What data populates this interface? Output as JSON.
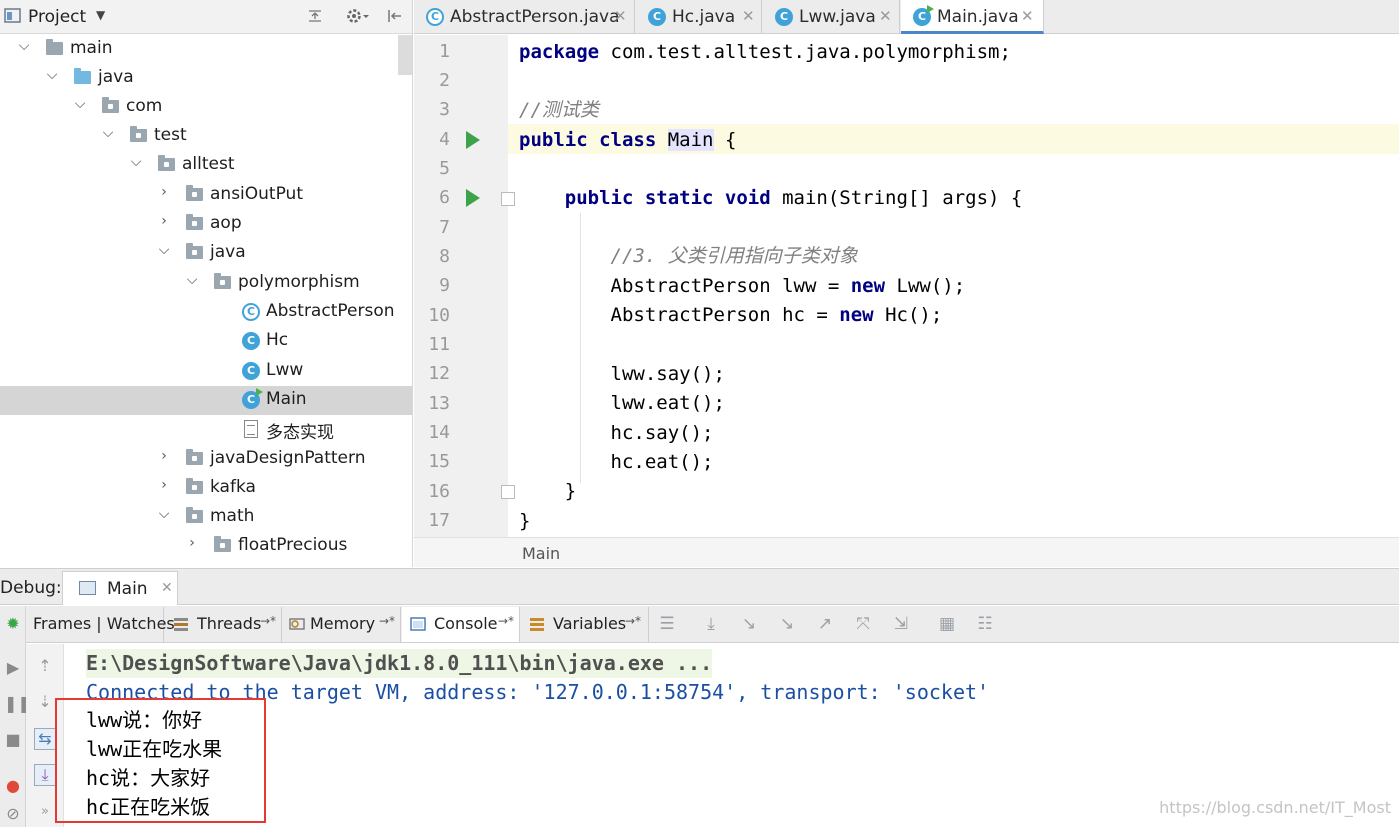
{
  "project_panel": {
    "title": "Project",
    "dropdown": "▼",
    "tree": [
      {
        "label": "main",
        "kind": "folder"
      },
      {
        "label": "java",
        "kind": "src-folder"
      },
      {
        "label": "com",
        "kind": "package"
      },
      {
        "label": "test",
        "kind": "package"
      },
      {
        "label": "alltest",
        "kind": "package"
      },
      {
        "label": "ansiOutPut",
        "kind": "package"
      },
      {
        "label": "aop",
        "kind": "package"
      },
      {
        "label": "java",
        "kind": "package"
      },
      {
        "label": "polymorphism",
        "kind": "package"
      },
      {
        "label": "AbstractPerson",
        "kind": "abstract-class"
      },
      {
        "label": "Hc",
        "kind": "class"
      },
      {
        "label": "Lww",
        "kind": "class"
      },
      {
        "label": "Main",
        "kind": "main-class",
        "selected": true
      },
      {
        "label": "多态实现",
        "kind": "file"
      },
      {
        "label": "javaDesignPattern",
        "kind": "package"
      },
      {
        "label": "kafka",
        "kind": "package"
      },
      {
        "label": "math",
        "kind": "package"
      },
      {
        "label": "floatPrecious",
        "kind": "package"
      }
    ]
  },
  "editor_tabs": [
    {
      "label": "AbstractPerson.java",
      "active": false
    },
    {
      "label": "Hc.java",
      "active": false
    },
    {
      "label": "Lww.java",
      "active": false
    },
    {
      "label": "Main.java",
      "active": true
    }
  ],
  "editor": {
    "line_numbers": [
      "1",
      "2",
      "3",
      "4",
      "5",
      "6",
      "7",
      "8",
      "9",
      "10",
      "11",
      "12",
      "13",
      "14",
      "15",
      "16",
      "17"
    ],
    "code": {
      "l1_kw": "package",
      "l1_rest": " com.test.alltest.java.polymorphism;",
      "l3": "//测试类",
      "l4_kw": "public class",
      "l4_name": "Main",
      "l4_rest": " {",
      "l6_indent": "    ",
      "l6_kw": "public static void",
      "l6_rest": " main(String[] args) {",
      "l8": "        //3. 父类引用指向子类对象",
      "l9_a": "        AbstractPerson lww = ",
      "l9_kw": "new",
      "l9_b": " Lww();",
      "l10_a": "        AbstractPerson hc = ",
      "l10_kw": "new",
      "l10_b": " Hc();",
      "l12": "        lww.say();",
      "l13": "        lww.eat();",
      "l14": "        hc.say();",
      "l15": "        hc.eat();",
      "l16": "    }",
      "l17": "}"
    },
    "breadcrumb": "Main"
  },
  "debug": {
    "label": "Debug:",
    "session_tab": "Main",
    "tabs": {
      "frames_watches": "Frames | Watches",
      "threads": "Threads",
      "memory": "Memory",
      "console": "Console",
      "variables": "Variables",
      "pin": "→*"
    },
    "console": {
      "cmd": "E:\\DesignSoftware\\Java\\jdk1.8.0_111\\bin\\java.exe ...",
      "connected": "Connected to the target VM, address: '127.0.0.1:58754', transport: 'socket'",
      "output": [
        "lww说：你好",
        "lww正在吃水果",
        "hc说：大家好",
        "hc正在吃米饭"
      ]
    }
  },
  "watermark": "https://blog.csdn.net/IT_Most",
  "colors": {
    "keyword": "#000080",
    "comment": "#808080",
    "console_link": "#1b4fa3",
    "highlight_box": "#e53935",
    "run_marker": "#3ca34a"
  }
}
